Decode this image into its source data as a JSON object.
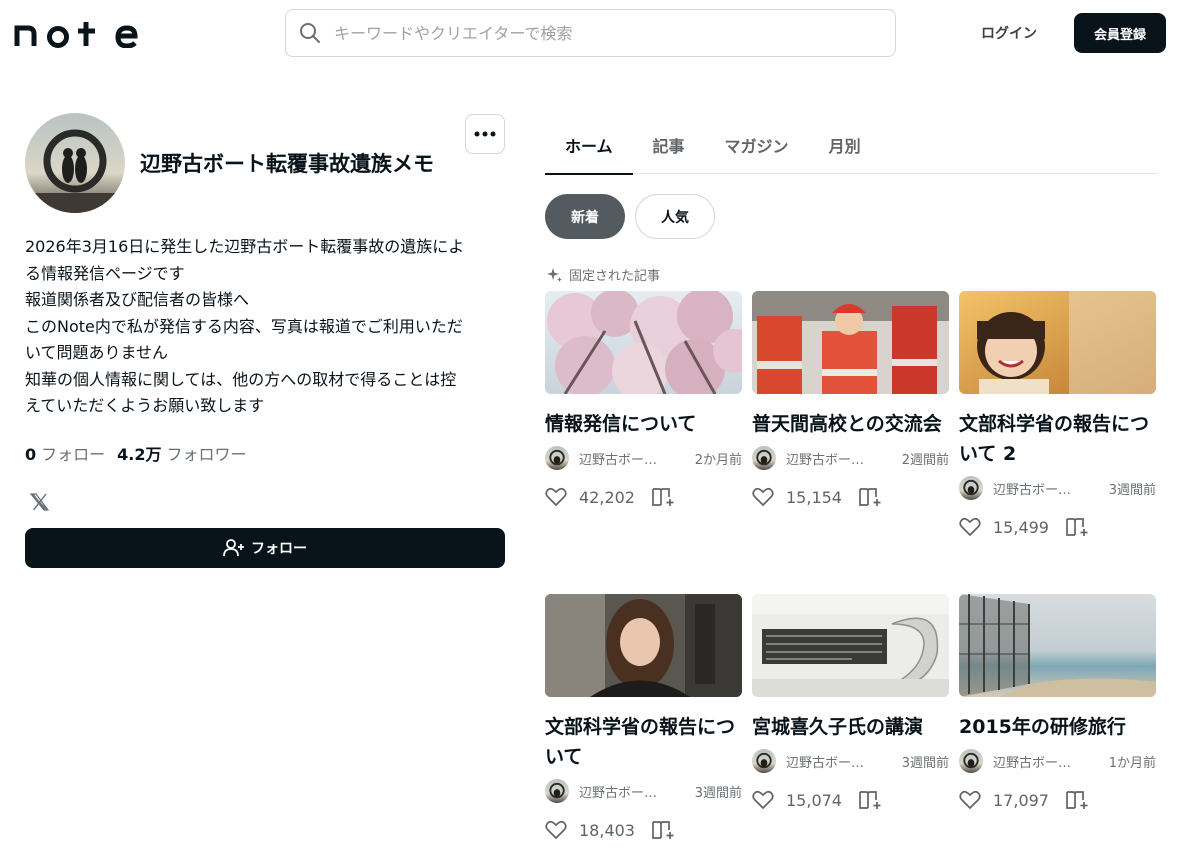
{
  "header": {
    "logo": "note",
    "search_placeholder": "キーワードやクリエイターで検索",
    "login": "ログイン",
    "signup": "会員登録"
  },
  "profile": {
    "name": "辺野古ボート転覆事故遺族メモ",
    "bio_lines": [
      "2026年3月16日に発生した辺野古ボート転覆事故の遺族によ",
      "る情報発信ページです",
      "報道関係者及び配信者の皆様へ",
      "このNote内で私が発信する内容、写真は報道でご利用いただ",
      "いて問題ありません",
      "知華の個人情報に関しては、他の方への取材で得ることは控",
      "えていただくようお願い致します"
    ],
    "following_count": "0",
    "following_label": "フォロー",
    "followers_count": "4.2万",
    "followers_label": "フォロワー",
    "follow_button": "フォロー"
  },
  "tabs": [
    {
      "label": "ホーム",
      "active": true
    },
    {
      "label": "記事"
    },
    {
      "label": "マガジン"
    },
    {
      "label": "月別"
    }
  ],
  "sort": {
    "new": "新着",
    "popular": "人気"
  },
  "pinned_label": "固定された記事",
  "articles": [
    {
      "title": "情報発信について",
      "author": "辺野古ボート転覆事故遺族メモ",
      "date": "2か月前",
      "likes": "42,202",
      "thumb": "sakura"
    },
    {
      "title": "普天間高校との交流会",
      "author": "辺野古ボート転覆事故遺族メモ",
      "date": "2週間前",
      "likes": "15,154",
      "thumb": "kids"
    },
    {
      "title": "文部科学省の報告について 2",
      "author": "辺野古ボート転覆事故遺族メモ",
      "date": "3週間前",
      "likes": "15,499",
      "thumb": "girl"
    },
    {
      "title": "文部科学省の報告について",
      "author": "辺野古ボート転覆事故遺族メモ",
      "date": "3週間前",
      "likes": "18,403",
      "thumb": "selfie"
    },
    {
      "title": "宮城喜久子氏の講演",
      "author": "辺野古ボート転覆事故遺族メモ",
      "date": "3週間前",
      "likes": "15,074",
      "thumb": "monument"
    },
    {
      "title": "2015年の研修旅行",
      "author": "辺野古ボート転覆事故遺族メモ",
      "date": "1か月前",
      "likes": "17,097",
      "thumb": "beach"
    }
  ],
  "colors": {
    "primary": "#08131a",
    "pill_active": "#535b61",
    "muted": "#6b7074",
    "border": "#d4d6d8"
  }
}
